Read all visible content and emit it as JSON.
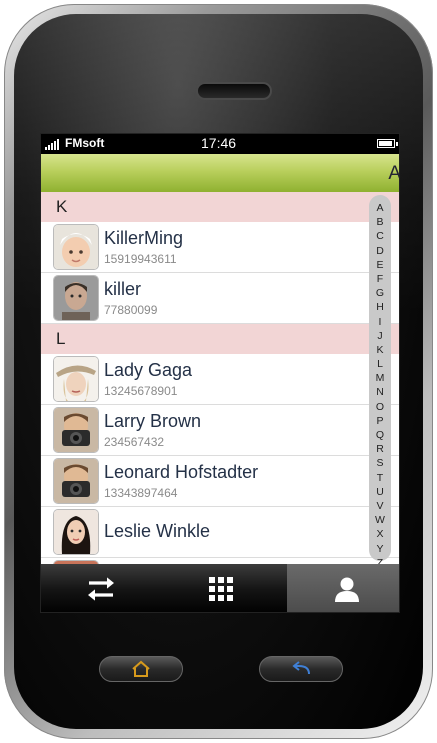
{
  "status_bar": {
    "carrier": "FMsoft",
    "time": "17:46"
  },
  "title_bar": {
    "title": "A"
  },
  "contacts": {
    "sections": [
      {
        "letter": "K",
        "items": [
          {
            "name": "KillerMing",
            "phone": "15919943611",
            "avatar": "baby-photo"
          },
          {
            "name": "killer",
            "phone": "77880099",
            "avatar": "man-photo"
          }
        ]
      },
      {
        "letter": "L",
        "items": [
          {
            "name": "Lady Gaga",
            "phone": "13245678901",
            "avatar": "woman-hat-photo"
          },
          {
            "name": "Larry Brown",
            "phone": "234567432",
            "avatar": "camera-man-photo"
          },
          {
            "name": "Leonard Hofstadter",
            "phone": "13343897464",
            "avatar": "camera-man-photo"
          },
          {
            "name": "Leslie Winkle",
            "phone": "",
            "avatar": "woman-photo"
          }
        ]
      }
    ]
  },
  "index_letters": [
    "A",
    "B",
    "C",
    "D",
    "E",
    "F",
    "G",
    "H",
    "I",
    "J",
    "K",
    "L",
    "M",
    "N",
    "O",
    "P",
    "Q",
    "R",
    "S",
    "T",
    "U",
    "V",
    "W",
    "X",
    "Y",
    "Z"
  ],
  "tab_bar": {
    "tabs": [
      {
        "icon": "swap-arrows-icon",
        "active": false
      },
      {
        "icon": "keypad-grid-icon",
        "active": false
      },
      {
        "icon": "contact-person-icon",
        "active": true
      }
    ]
  },
  "hardware_buttons": {
    "home_icon": "home-icon",
    "back_icon": "back-arrow-icon",
    "home_color": "#d79a1c",
    "back_color": "#3f7fd4"
  },
  "colors": {
    "title_bar_top": "#d7e48e",
    "title_bar_bottom": "#8fb130",
    "section_header": "#f2d5d5",
    "index_bar": "#c9c9c9",
    "name_text": "#243147"
  }
}
